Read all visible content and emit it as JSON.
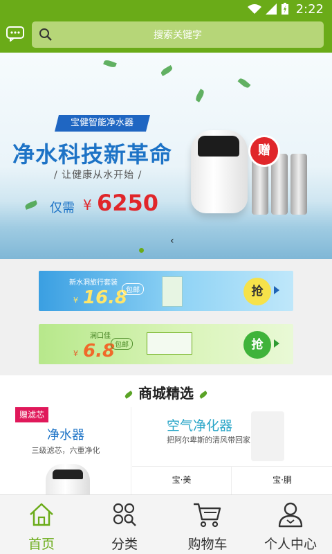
{
  "status_bar": {
    "time": "2:22"
  },
  "header": {
    "search_placeholder": "搜索关键字"
  },
  "hero": {
    "tagline": "宝健智能净水器",
    "headline": "净水科技新革命",
    "subline": "/ 让健康从水开始 /",
    "price_label": "仅需",
    "price_symbol": "¥",
    "price": "6250",
    "gift": "赠",
    "slide_count": 1,
    "active_slide": 1
  },
  "promos": [
    {
      "title": "新水洞旅行套装",
      "symbol": "¥",
      "price": "16.8",
      "tag": "包邮",
      "cta": "抢"
    },
    {
      "title": "润口佳",
      "symbol": "¥",
      "price": "6.8",
      "tag": "包邮",
      "cta": "抢"
    }
  ],
  "mall": {
    "title": "商城精选",
    "left_card": {
      "badge": "赠滤芯",
      "name": "净水器",
      "desc": "三级滤芯，六重净化"
    },
    "right_card": {
      "name": "空气净化器",
      "desc": "把阿尔卑斯的清风带回家"
    },
    "mini_items": [
      "宝·美",
      "宝·胴"
    ]
  },
  "bottom_nav": [
    {
      "label": "首页",
      "icon": "home-icon",
      "active": true
    },
    {
      "label": "分类",
      "icon": "category-icon",
      "active": false
    },
    {
      "label": "购物车",
      "icon": "cart-icon",
      "active": false
    },
    {
      "label": "个人中心",
      "icon": "profile-icon",
      "active": false
    }
  ],
  "colors": {
    "brand_green": "#6aab18",
    "price_red": "#e0262a",
    "title_blue": "#1d73c6"
  }
}
